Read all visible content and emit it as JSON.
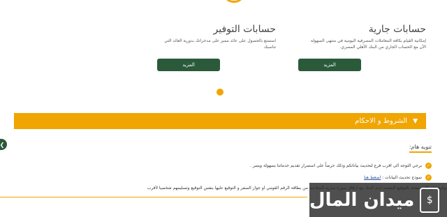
{
  "cards": [
    {
      "title": "حسابات جارية",
      "desc_line1": "إمكانية القيام بكافة المعاملات المصرفية اليومية في منتهى السهولة",
      "desc_line2": "الآن مع الحساب الجاري من البنك الأهلي المصري.",
      "button_label": "المزيد"
    },
    {
      "title": "حسابات التوفير",
      "desc_line1": "استمتع بالحصول على عائد مميز على مدخراتك بدورية العائد التي",
      "desc_line2": "تناسبك",
      "button_label": "المزيد"
    }
  ],
  "terms": {
    "label": "الشروط و الاحكام",
    "chevron": "▼"
  },
  "notice": {
    "title": "تنويه هام:",
    "line1": "برجي التوجه الى اقرب فرع لتحديث بياناتكم وذلك حرصاً على استمرار تقديم خدماتنا بسهولة ويسر .",
    "line2_text": "نموذج تحديث البيانات : ",
    "line2_link": "اضغط هنا",
    "line3": "توقيع على كل صفحة بالتوقيع المعتمد لدى البنك مع ارفاق صورة سارية الصلاحية من بطاقة الرقم القومي أو جواز السفر و التوقيع عليها بنفس التوقيع وتسليمهم شخصيا لأقرب"
  },
  "watermark": {
    "text": "ميدان المال",
    "logo_glyph": "$"
  },
  "colors": {
    "accent": "#f0a500",
    "button": "#2a5a3a",
    "link": "#2a4fa0"
  }
}
